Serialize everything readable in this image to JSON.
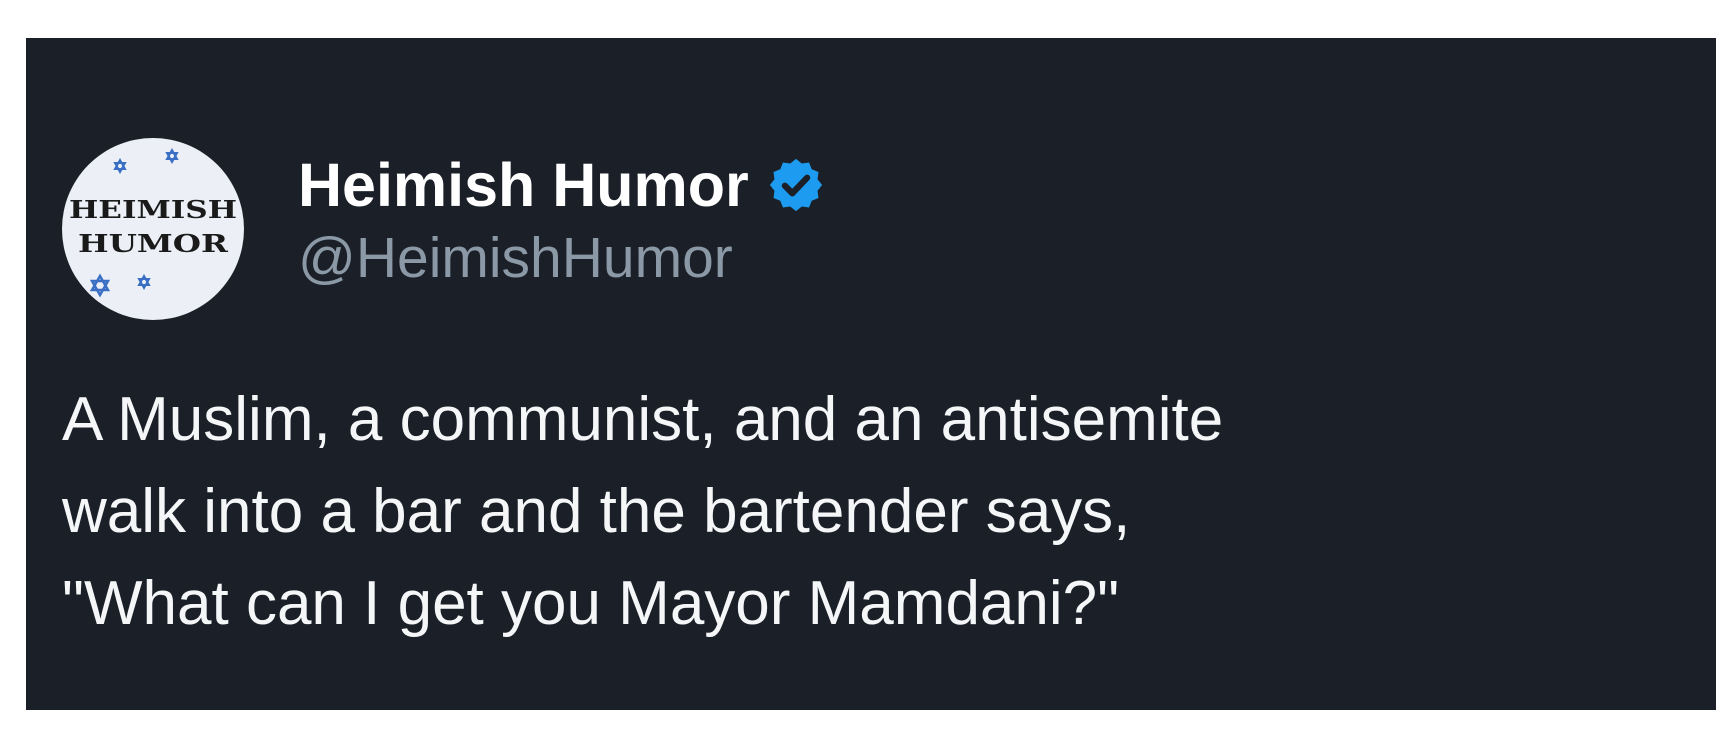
{
  "tweet": {
    "avatar": {
      "line1": "HEIMISH",
      "line2": "HUMOR",
      "accent_color": "#3a6fc4",
      "background_color": "#ecf0f6"
    },
    "display_name": "Heimish Humor",
    "verified_icon": "verified-badge-icon",
    "verified_color": "#1d9bf0",
    "handle": "@HeimishHumor",
    "text_lines": [
      "A Muslim, a communist, and an antisemite",
      "walk into a bar and the bartender says,",
      "\"What can I get you Mayor Mamdani?\""
    ],
    "colors": {
      "card_background": "#1b2028",
      "name_color": "#ffffff",
      "handle_color": "#8b98a5",
      "text_color": "#f4f6f8"
    }
  }
}
